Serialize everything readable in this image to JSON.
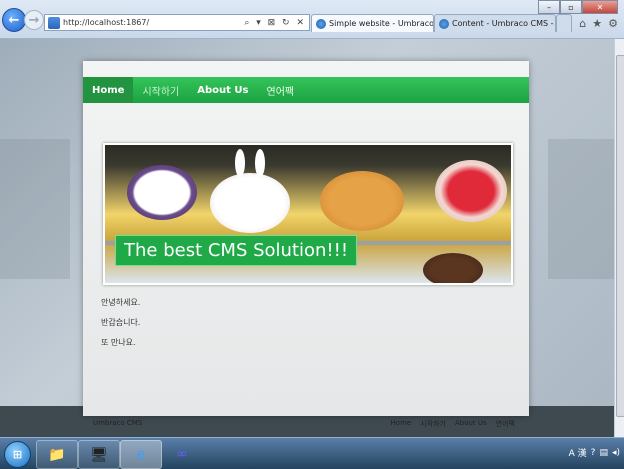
{
  "browser": {
    "address_url": "http://localhost:1867/",
    "address_tools": "⌕ ▾ ⊠ ↻ ✕",
    "tabs": [
      {
        "title": "Simple website - Umbraco...",
        "close": "×"
      },
      {
        "title": "Content - Umbraco CMS - lo..."
      }
    ],
    "window_controls": [
      "–",
      "▫",
      "✕"
    ],
    "toolbar_icons": [
      "home-icon",
      "favorites-star-icon",
      "tools-gear-icon"
    ]
  },
  "site": {
    "menu": [
      {
        "label": "Home"
      },
      {
        "label": "시작하기"
      },
      {
        "label": "About Us"
      },
      {
        "label": "연어팩"
      }
    ],
    "banner_caption": "The best CMS Solution!!!",
    "content_lines": [
      "안녕하세요.",
      "반갑습니다.",
      "또 만나요."
    ],
    "footer": {
      "left": "Umbraco CMS",
      "links": [
        "Home",
        "시작하기",
        "About Us",
        "연어팩"
      ]
    }
  },
  "taskbar": {
    "apps": [
      {
        "name": "file-explorer-icon"
      },
      {
        "name": "server-manager-icon"
      },
      {
        "name": "internet-explorer-icon"
      },
      {
        "name": "visual-studio-icon"
      }
    ],
    "tray_text": "A 漢"
  },
  "colors": {
    "menu_green": "#22b04a",
    "menu_selected": "#22933e",
    "banner_caption_bg": "#1faa47",
    "footer_dark": "#3f4a50"
  }
}
